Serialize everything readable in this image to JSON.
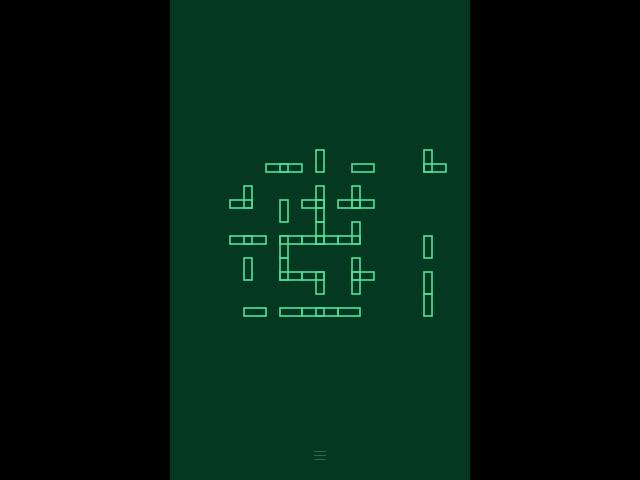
{
  "game": {
    "name": "pipe-rotation-puzzle",
    "grid": {
      "rows": 6,
      "cols": 6
    },
    "line_color": "#4fe39a",
    "background_color": "#053820",
    "outer_color": "#000000",
    "tiles": [
      {
        "row": 0,
        "col": 0,
        "type": "empty",
        "openings": []
      },
      {
        "row": 0,
        "col": 1,
        "type": "straight",
        "openings": [
          "E",
          "W"
        ]
      },
      {
        "row": 0,
        "col": 2,
        "type": "end",
        "openings": [
          "N"
        ]
      },
      {
        "row": 0,
        "col": 3,
        "type": "end",
        "openings": [
          "E"
        ]
      },
      {
        "row": 0,
        "col": 4,
        "type": "empty",
        "openings": []
      },
      {
        "row": 0,
        "col": 5,
        "type": "elbow",
        "openings": [
          "N",
          "E"
        ]
      },
      {
        "row": 1,
        "col": 0,
        "type": "elbow",
        "openings": [
          "N",
          "W"
        ]
      },
      {
        "row": 1,
        "col": 1,
        "type": "end",
        "openings": [
          "S"
        ]
      },
      {
        "row": 1,
        "col": 2,
        "type": "tee",
        "openings": [
          "N",
          "S",
          "W"
        ]
      },
      {
        "row": 1,
        "col": 3,
        "type": "tee",
        "openings": [
          "N",
          "E",
          "W"
        ]
      },
      {
        "row": 1,
        "col": 4,
        "type": "empty",
        "openings": []
      },
      {
        "row": 1,
        "col": 5,
        "type": "empty",
        "openings": []
      },
      {
        "row": 2,
        "col": 0,
        "type": "straight",
        "openings": [
          "E",
          "W"
        ]
      },
      {
        "row": 2,
        "col": 1,
        "type": "elbow",
        "openings": [
          "E",
          "S"
        ]
      },
      {
        "row": 2,
        "col": 2,
        "type": "tee",
        "openings": [
          "N",
          "E",
          "W"
        ]
      },
      {
        "row": 2,
        "col": 3,
        "type": "elbow",
        "openings": [
          "N",
          "W"
        ]
      },
      {
        "row": 2,
        "col": 4,
        "type": "empty",
        "openings": []
      },
      {
        "row": 2,
        "col": 5,
        "type": "end",
        "openings": [
          "S"
        ]
      },
      {
        "row": 3,
        "col": 0,
        "type": "end",
        "openings": [
          "N"
        ]
      },
      {
        "row": 3,
        "col": 1,
        "type": "elbow",
        "openings": [
          "N",
          "E"
        ]
      },
      {
        "row": 3,
        "col": 2,
        "type": "elbow",
        "openings": [
          "W",
          "S"
        ]
      },
      {
        "row": 3,
        "col": 3,
        "type": "tee",
        "openings": [
          "N",
          "E",
          "S"
        ]
      },
      {
        "row": 3,
        "col": 4,
        "type": "empty",
        "openings": []
      },
      {
        "row": 3,
        "col": 5,
        "type": "end",
        "openings": [
          "S"
        ]
      },
      {
        "row": 4,
        "col": 0,
        "type": "end",
        "openings": [
          "E"
        ]
      },
      {
        "row": 4,
        "col": 1,
        "type": "end",
        "openings": [
          "E"
        ]
      },
      {
        "row": 4,
        "col": 2,
        "type": "straight",
        "openings": [
          "E",
          "W"
        ]
      },
      {
        "row": 4,
        "col": 3,
        "type": "end",
        "openings": [
          "W"
        ]
      },
      {
        "row": 4,
        "col": 4,
        "type": "empty",
        "openings": []
      },
      {
        "row": 4,
        "col": 5,
        "type": "end",
        "openings": [
          "N"
        ]
      },
      {
        "row": 5,
        "col": 0,
        "type": "empty",
        "openings": []
      },
      {
        "row": 5,
        "col": 1,
        "type": "empty",
        "openings": []
      },
      {
        "row": 5,
        "col": 2,
        "type": "empty",
        "openings": []
      },
      {
        "row": 5,
        "col": 3,
        "type": "empty",
        "openings": []
      },
      {
        "row": 5,
        "col": 4,
        "type": "empty",
        "openings": []
      },
      {
        "row": 5,
        "col": 5,
        "type": "empty",
        "openings": []
      }
    ]
  },
  "footer": {
    "menu_icon": "hamburger-menu-icon"
  }
}
